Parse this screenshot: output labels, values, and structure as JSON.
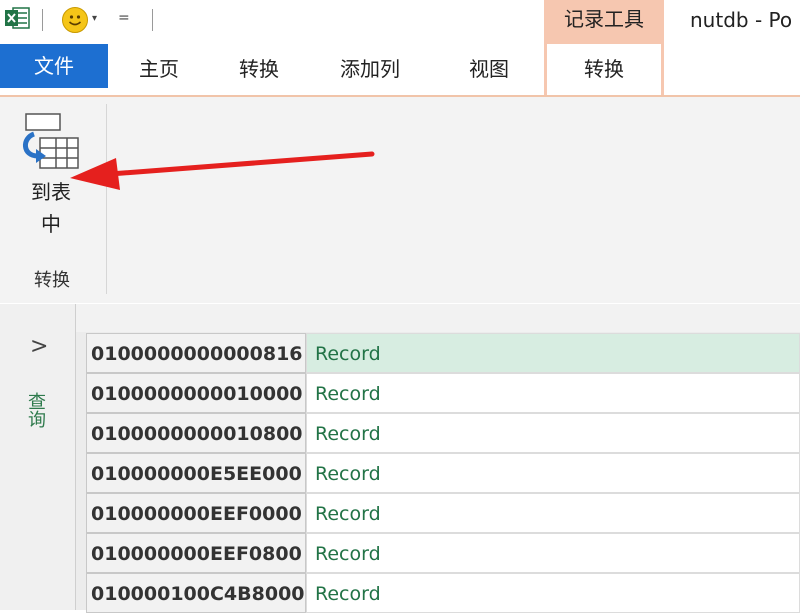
{
  "titlebar": {
    "qat_dropdown": "▾",
    "qat_customize": "=",
    "context_group": "记录工具",
    "window_title": "nutdb - Po"
  },
  "tabs": {
    "file": "文件",
    "home": "主页",
    "transform": "转换",
    "add_column": "添加列",
    "view": "视图",
    "active_context_tab": "转换"
  },
  "ribbon": {
    "to_table_label": "到表\n中",
    "group_label": "转换"
  },
  "navigator": {
    "expand_glyph": ">",
    "pane_label": "查询"
  },
  "grid": {
    "rows": [
      {
        "key": "0100000000000816",
        "value": "Record"
      },
      {
        "key": "0100000000010000",
        "value": "Record"
      },
      {
        "key": "0100000000010800",
        "value": "Record"
      },
      {
        "key": "010000000E5EE000",
        "value": "Record"
      },
      {
        "key": "010000000EEF0000",
        "value": "Record"
      },
      {
        "key": "010000000EEF0800",
        "value": "Record"
      },
      {
        "key": "010000100C4B8000",
        "value": "Record"
      }
    ]
  },
  "colors": {
    "file_tab": "#1d6fd1",
    "context_tab": "#f6c7b0",
    "record_text": "#217346",
    "selected_row": "#d7ede1",
    "arrow": "#e5201e"
  },
  "icons": [
    "excel-icon",
    "smiley-icon",
    "to-table-icon",
    "chevron-right-icon"
  ]
}
